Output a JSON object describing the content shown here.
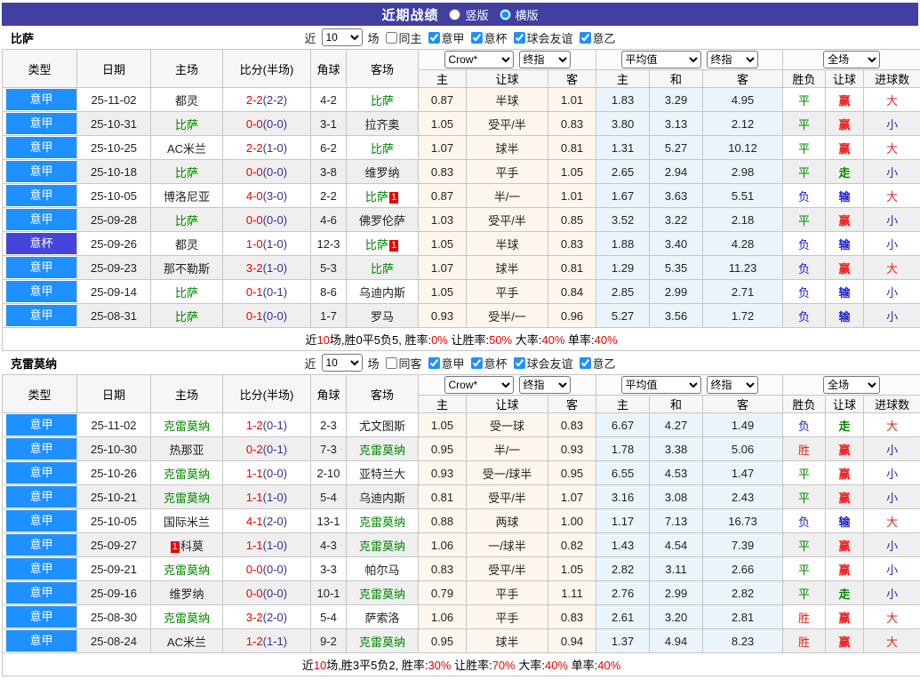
{
  "palette": {
    "bar_bg": "#413f9f",
    "league_blue": "#1e90ff",
    "cup_blue": "#4545dd",
    "team_green": "#008800",
    "score_red": "#ee0000",
    "score_half_navy": "#333399",
    "win_red": "#ee2222",
    "draw_green": "#008800",
    "lose_blue": "#2222cc",
    "odds_bg": "#fdf6ec",
    "avg_bg": "#eaf4fb",
    "alt_row_bg": "#efefef",
    "summary_red": "#ee0000",
    "control_blue": "#1e90ff"
  },
  "topbar": {
    "title": "近期战绩",
    "radios": [
      {
        "label": "竖版",
        "selected": false
      },
      {
        "label": "横版",
        "selected": true
      }
    ]
  },
  "filter": {
    "recent_label": "近",
    "count": "10",
    "matches_label": "场"
  },
  "table_header": {
    "static_cols": [
      "类型",
      "日期",
      "主场",
      "比分(半场)",
      "角球",
      "客场"
    ],
    "odds_group": {
      "selects": [
        "Crow*",
        "终指"
      ],
      "cols": [
        "主",
        "让球",
        "客"
      ]
    },
    "avg_group": {
      "selects": [
        "平均值",
        "终指"
      ],
      "cols": [
        "主",
        "和",
        "客"
      ]
    },
    "result_group": {
      "selects": [
        "全场"
      ],
      "cols": [
        "胜负",
        "让球",
        "进球数"
      ]
    }
  },
  "sections": [
    {
      "team": "比萨",
      "same_checkbox": {
        "label": "同主",
        "checked": false
      },
      "league_checkboxes": [
        {
          "label": "意甲",
          "checked": true
        },
        {
          "label": "意杯",
          "checked": true
        },
        {
          "label": "球会友谊",
          "checked": true
        },
        {
          "label": "意乙",
          "checked": true
        }
      ],
      "rows": [
        {
          "type": "意甲",
          "cup": false,
          "date": "25-11-02",
          "home": "都灵",
          "home_team": false,
          "score": "2-2",
          "half": "(2-2)",
          "corner": "4-2",
          "away": "比萨",
          "away_team": true,
          "odds": [
            "0.87",
            "半球",
            "1.01"
          ],
          "avg": [
            "1.83",
            "3.29",
            "4.95"
          ],
          "results": [
            "平",
            "赢",
            "大"
          ]
        },
        {
          "type": "意甲",
          "cup": false,
          "date": "25-10-31",
          "home": "比萨",
          "home_team": true,
          "score": "0-0",
          "half": "(0-0)",
          "corner": "3-1",
          "away": "拉齐奥",
          "away_team": false,
          "odds": [
            "1.05",
            "受平/半",
            "0.83"
          ],
          "avg": [
            "3.80",
            "3.13",
            "2.12"
          ],
          "results": [
            "平",
            "赢",
            "小"
          ]
        },
        {
          "type": "意甲",
          "cup": false,
          "date": "25-10-25",
          "home": "AC米兰",
          "home_team": false,
          "score": "2-2",
          "half": "(1-0)",
          "corner": "6-2",
          "away": "比萨",
          "away_team": true,
          "odds": [
            "1.07",
            "球半",
            "0.81"
          ],
          "avg": [
            "1.31",
            "5.27",
            "10.12"
          ],
          "results": [
            "平",
            "赢",
            "大"
          ]
        },
        {
          "type": "意甲",
          "cup": false,
          "date": "25-10-18",
          "home": "比萨",
          "home_team": true,
          "score": "0-0",
          "half": "(0-0)",
          "corner": "3-8",
          "away": "维罗纳",
          "away_team": false,
          "odds": [
            "0.83",
            "平手",
            "1.05"
          ],
          "avg": [
            "2.65",
            "2.94",
            "2.98"
          ],
          "results": [
            "平",
            "走",
            "小"
          ]
        },
        {
          "type": "意甲",
          "cup": false,
          "date": "25-10-05",
          "home": "博洛尼亚",
          "home_team": false,
          "score": "4-0",
          "half": "(3-0)",
          "corner": "2-2",
          "away": "比萨",
          "away_team": true,
          "away_badge": {
            "pos": "post",
            "text": "1"
          },
          "odds": [
            "0.87",
            "半/一",
            "1.01"
          ],
          "avg": [
            "1.67",
            "3.63",
            "5.51"
          ],
          "results": [
            "负",
            "输",
            "大"
          ]
        },
        {
          "type": "意甲",
          "cup": false,
          "date": "25-09-28",
          "home": "比萨",
          "home_team": true,
          "score": "0-0",
          "half": "(0-0)",
          "corner": "4-6",
          "away": "佛罗伦萨",
          "away_team": false,
          "odds": [
            "1.03",
            "受平/半",
            "0.85"
          ],
          "avg": [
            "3.52",
            "3.22",
            "2.18"
          ],
          "results": [
            "平",
            "赢",
            "小"
          ]
        },
        {
          "type": "意杯",
          "cup": true,
          "date": "25-09-26",
          "home": "都灵",
          "home_team": false,
          "score": "1-0",
          "half": "(1-0)",
          "corner": "12-3",
          "away": "比萨",
          "away_team": true,
          "away_badge": {
            "pos": "post",
            "text": "1"
          },
          "odds": [
            "1.05",
            "半球",
            "0.83"
          ],
          "avg": [
            "1.88",
            "3.40",
            "4.28"
          ],
          "results": [
            "负",
            "输",
            "小"
          ]
        },
        {
          "type": "意甲",
          "cup": false,
          "date": "25-09-23",
          "home": "那不勒斯",
          "home_team": false,
          "score": "3-2",
          "half": "(1-0)",
          "corner": "5-3",
          "away": "比萨",
          "away_team": true,
          "odds": [
            "1.07",
            "球半",
            "0.81"
          ],
          "avg": [
            "1.29",
            "5.35",
            "11.23"
          ],
          "results": [
            "负",
            "赢",
            "大"
          ]
        },
        {
          "type": "意甲",
          "cup": false,
          "date": "25-09-14",
          "home": "比萨",
          "home_team": true,
          "score": "0-1",
          "half": "(0-1)",
          "corner": "8-6",
          "away": "乌迪内斯",
          "away_team": false,
          "odds": [
            "1.05",
            "平手",
            "0.84"
          ],
          "avg": [
            "2.85",
            "2.99",
            "2.71"
          ],
          "results": [
            "负",
            "输",
            "小"
          ]
        },
        {
          "type": "意甲",
          "cup": false,
          "date": "25-08-31",
          "home": "比萨",
          "home_team": true,
          "score": "0-1",
          "half": "(0-0)",
          "corner": "1-7",
          "away": "罗马",
          "away_team": false,
          "odds": [
            "0.93",
            "受半/一",
            "0.96"
          ],
          "avg": [
            "5.27",
            "3.56",
            "1.72"
          ],
          "results": [
            "负",
            "输",
            "小"
          ]
        }
      ],
      "summary": [
        {
          "text": "近",
          "red": false
        },
        {
          "text": "10",
          "red": true
        },
        {
          "text": "场,胜0平5负5, 胜率:",
          "red": false
        },
        {
          "text": "0%",
          "red": true
        },
        {
          "text": " 让胜率:",
          "red": false
        },
        {
          "text": "50%",
          "red": true
        },
        {
          "text": " 大率:",
          "red": false
        },
        {
          "text": "40%",
          "red": true
        },
        {
          "text": " 单率:",
          "red": false
        },
        {
          "text": "40%",
          "red": true
        }
      ]
    },
    {
      "team": "克雷莫纳",
      "same_checkbox": {
        "label": "同客",
        "checked": false
      },
      "league_checkboxes": [
        {
          "label": "意甲",
          "checked": true
        },
        {
          "label": "意杯",
          "checked": true
        },
        {
          "label": "球会友谊",
          "checked": true
        },
        {
          "label": "意乙",
          "checked": true
        }
      ],
      "rows": [
        {
          "type": "意甲",
          "cup": false,
          "date": "25-11-02",
          "home": "克雷莫纳",
          "home_team": true,
          "score": "1-2",
          "half": "(0-1)",
          "corner": "2-3",
          "away": "尤文图斯",
          "away_team": false,
          "odds": [
            "1.05",
            "受一球",
            "0.83"
          ],
          "avg": [
            "6.67",
            "4.27",
            "1.49"
          ],
          "results": [
            "负",
            "走",
            "大"
          ]
        },
        {
          "type": "意甲",
          "cup": false,
          "date": "25-10-30",
          "home": "热那亚",
          "home_team": false,
          "score": "0-2",
          "half": "(0-1)",
          "corner": "7-3",
          "away": "克雷莫纳",
          "away_team": true,
          "odds": [
            "0.95",
            "半/一",
            "0.93"
          ],
          "avg": [
            "1.78",
            "3.38",
            "5.06"
          ],
          "results": [
            "胜",
            "赢",
            "小"
          ]
        },
        {
          "type": "意甲",
          "cup": false,
          "date": "25-10-26",
          "home": "克雷莫纳",
          "home_team": true,
          "score": "1-1",
          "half": "(0-0)",
          "corner": "2-10",
          "away": "亚特兰大",
          "away_team": false,
          "odds": [
            "0.93",
            "受一/球半",
            "0.95"
          ],
          "avg": [
            "6.55",
            "4.53",
            "1.47"
          ],
          "results": [
            "平",
            "赢",
            "小"
          ]
        },
        {
          "type": "意甲",
          "cup": false,
          "date": "25-10-21",
          "home": "克雷莫纳",
          "home_team": true,
          "score": "1-1",
          "half": "(1-0)",
          "corner": "5-4",
          "away": "乌迪内斯",
          "away_team": false,
          "odds": [
            "0.81",
            "受平/半",
            "1.07"
          ],
          "avg": [
            "3.16",
            "3.08",
            "2.43"
          ],
          "results": [
            "平",
            "赢",
            "小"
          ]
        },
        {
          "type": "意甲",
          "cup": false,
          "date": "25-10-05",
          "home": "国际米兰",
          "home_team": false,
          "score": "4-1",
          "half": "(2-0)",
          "corner": "13-1",
          "away": "克雷莫纳",
          "away_team": true,
          "odds": [
            "0.88",
            "两球",
            "1.00"
          ],
          "avg": [
            "1.17",
            "7.13",
            "16.73"
          ],
          "results": [
            "负",
            "输",
            "大"
          ]
        },
        {
          "type": "意甲",
          "cup": false,
          "date": "25-09-27",
          "home": "科莫",
          "home_team": false,
          "home_badge": {
            "pos": "pre",
            "text": "1"
          },
          "score": "1-1",
          "half": "(1-0)",
          "corner": "4-3",
          "away": "克雷莫纳",
          "away_team": true,
          "odds": [
            "1.06",
            "一/球半",
            "0.82"
          ],
          "avg": [
            "1.43",
            "4.54",
            "7.39"
          ],
          "results": [
            "平",
            "赢",
            "小"
          ]
        },
        {
          "type": "意甲",
          "cup": false,
          "date": "25-09-21",
          "home": "克雷莫纳",
          "home_team": true,
          "score": "0-0",
          "half": "(0-0)",
          "corner": "3-3",
          "away": "帕尔马",
          "away_team": false,
          "odds": [
            "0.83",
            "受平/半",
            "1.05"
          ],
          "avg": [
            "2.82",
            "3.11",
            "2.66"
          ],
          "results": [
            "平",
            "赢",
            "小"
          ]
        },
        {
          "type": "意甲",
          "cup": false,
          "date": "25-09-16",
          "home": "维罗纳",
          "home_team": false,
          "score": "0-0",
          "half": "(0-0)",
          "corner": "10-1",
          "away": "克雷莫纳",
          "away_team": true,
          "odds": [
            "0.79",
            "平手",
            "1.11"
          ],
          "avg": [
            "2.76",
            "2.99",
            "2.82"
          ],
          "results": [
            "平",
            "走",
            "小"
          ]
        },
        {
          "type": "意甲",
          "cup": false,
          "date": "25-08-30",
          "home": "克雷莫纳",
          "home_team": true,
          "score": "3-2",
          "half": "(2-0)",
          "corner": "5-4",
          "away": "萨索洛",
          "away_team": false,
          "odds": [
            "1.06",
            "平手",
            "0.83"
          ],
          "avg": [
            "2.61",
            "3.20",
            "2.81"
          ],
          "results": [
            "胜",
            "赢",
            "大"
          ]
        },
        {
          "type": "意甲",
          "cup": false,
          "date": "25-08-24",
          "home": "AC米兰",
          "home_team": false,
          "score": "1-2",
          "half": "(1-1)",
          "corner": "9-2",
          "away": "克雷莫纳",
          "away_team": true,
          "odds": [
            "0.95",
            "球半",
            "0.94"
          ],
          "avg": [
            "1.37",
            "4.94",
            "8.23"
          ],
          "results": [
            "胜",
            "赢",
            "大"
          ]
        }
      ],
      "summary": [
        {
          "text": "近",
          "red": false
        },
        {
          "text": "10",
          "red": true
        },
        {
          "text": "场,胜3平5负2, 胜率:",
          "red": false
        },
        {
          "text": "30%",
          "red": true
        },
        {
          "text": " 让胜率:",
          "red": false
        },
        {
          "text": "70%",
          "red": true
        },
        {
          "text": " 大率:",
          "red": false
        },
        {
          "text": "40%",
          "red": true
        },
        {
          "text": " 单率:",
          "red": false
        },
        {
          "text": "40%",
          "red": true
        }
      ]
    }
  ]
}
